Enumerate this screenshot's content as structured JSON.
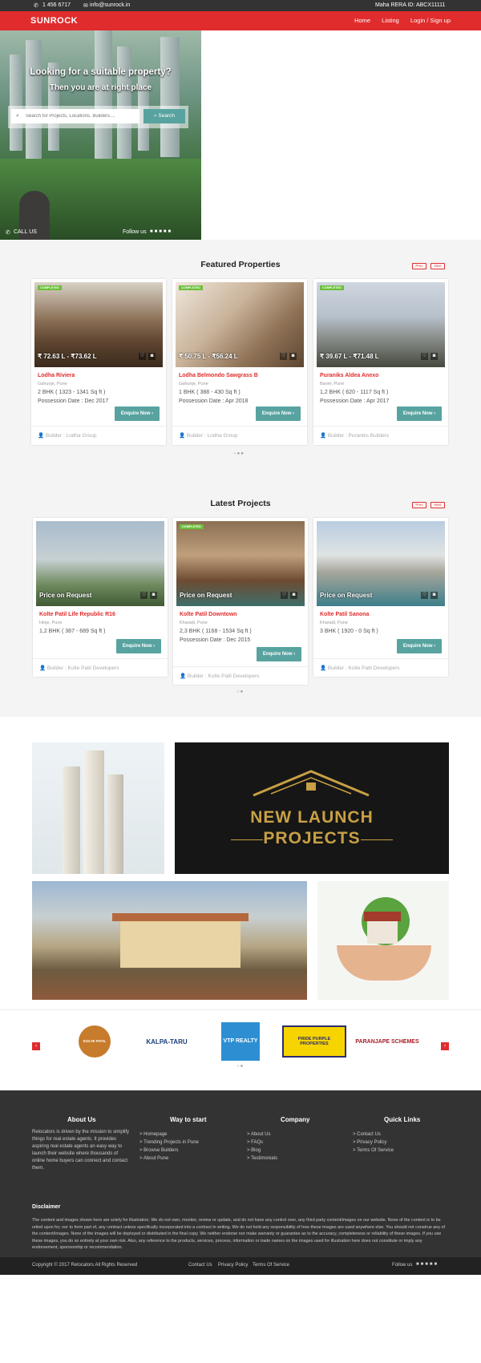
{
  "topbar": {
    "phone": "1 456 6717",
    "email": "info@sunrock.in",
    "rera": "Maha RERA ID: ABCX11111"
  },
  "brand": {
    "logo": "SUNROCK"
  },
  "nav": {
    "items": [
      "Home",
      "Listing",
      "Login / Sign up"
    ]
  },
  "hero": {
    "title": "Looking for a suitable property?",
    "subtitle": "Then you are at right place",
    "search_placeholder": "Search for Projects, Locations, Builders....",
    "search_button": "Search",
    "call": "CALL US",
    "follow": "Follow us"
  },
  "featured": {
    "title": "Featured Properties",
    "prev": "Prev",
    "next": "Next",
    "cards": [
      {
        "badge": "COMPLETED",
        "price": "₹ 72.63 L - ₹73.62 L",
        "name": "Lodha Riviera",
        "location": "Gahunje, Pune",
        "config": "2 BHK   ( 1323 - 1341 Sq ft )",
        "possession": "Possession Date : Dec 2017",
        "button": "Enquire Now",
        "builder": "Builder : Lodha Group"
      },
      {
        "badge": "COMPLETED",
        "price": "₹ 50.75 L - ₹56.24 L",
        "name": "Lodha Belmondo Sawgrass B",
        "location": "Gahunje, Pune",
        "config": "1 BHK   ( 388 - 430 Sq ft )",
        "possession": "Possession Date : Apr 2018",
        "button": "Enquire Now",
        "builder": "Builder : Lodha Group"
      },
      {
        "badge": "COMPLETED",
        "price": "₹ 39.67 L - ₹71.48 L",
        "name": "Puraniks Aldea Anexo",
        "location": "Baner, Pune",
        "config": "1,2 BHK   ( 620 - 1117 Sq ft )",
        "possession": "Possession Date : Apr 2017",
        "button": "Enquire Now",
        "builder": "Builder : Puraniks Builders"
      }
    ]
  },
  "latest": {
    "title": "Latest Projects",
    "prev": "Prev",
    "next": "Next",
    "cards": [
      {
        "price": "Price on Request",
        "name": "Kolte Patil Life Republic R16",
        "location": "Hinje, Pune",
        "config": "1,2 BHK   ( 387 - 689 Sq ft )",
        "button": "Enquire Now",
        "builder": "Builder : Kolte Patil Developers"
      },
      {
        "badge": "COMPLETED",
        "price": "Price on Request",
        "name": "Kolte Patil Downtown",
        "location": "Kharadi, Pune",
        "config": "2,3 BHK   ( 1168 - 1534 Sq ft )",
        "possession": "Possession Date : Dec 2015",
        "button": "Enquire Now",
        "builder": "Builder : Kolte Patil Developers"
      },
      {
        "price": "Price on Request",
        "name": "Kolte Patil Sanona",
        "location": "Kharadi, Pune",
        "config": "3 BHK   ( 1920 - 0 Sq ft )",
        "button": "Enquire Now",
        "builder": "Builder : Kolte Patil Developers"
      }
    ]
  },
  "banners": {
    "line1": "NEW LAUNCH",
    "line2": "PROJECTS"
  },
  "partners": [
    "KOLTE PATIL",
    "KALPA-TARU",
    "VTP REALTY",
    "PRIDE PURPLE PROPERTIES",
    "PARANJAPE SCHEMES"
  ],
  "footer": {
    "about_title": "About Us",
    "about_text": "Relocators is driven by the mission to simplify things for real estate agents. It provides aspiring real estate agents an easy way to launch their website where thousands of online home buyers can connect and contact them.",
    "way_title": "Way to start",
    "way_links": [
      "> Homepage",
      "> Trending Projects in Pune",
      "> Browse Builders",
      "> About Pune"
    ],
    "company_title": "Company",
    "company_links": [
      "> About Us",
      "> FAQs",
      "> Blog",
      "> Testimonials"
    ],
    "quick_title": "Quick Links",
    "quick_links": [
      "> Contact Us",
      "> Privacy Policy",
      "> Terms Of Service"
    ],
    "disclaimer_title": "Disclaimer",
    "disclaimer_text": "The content and images shown here are solely for illustration. We do not own, monitor, review or update, and do not have any control over, any third party content/images on our website. None of the content is to be relied upon for, nor to form part of, any contract unless specifically incorporated into a contract in writing. We do not hold any responsibility of how these images are used anywhere else. You should not construe any of the content/images. None of the images will be deployed or distributed in the final copy. We neither endorse nor make warranty or guarantee as to the accuracy, completeness or reliability of these images. If you use these images, you do so entirely at your own risk. Also, any reference to the products, services, process, information or trade names on the images used for illustration here does not constitute or imply any endorsement, sponsorship or recommendation.",
    "copyright": "Copyright © 2017 Relocators All Rights Reserved",
    "bottom_links": [
      "Contact Us",
      "Privacy Policy",
      "Terms Of Service"
    ],
    "follow": "Follow us"
  },
  "colors": {
    "brand_red": "#e02c2c",
    "teal": "#58a3a0",
    "footer": "#333333"
  }
}
